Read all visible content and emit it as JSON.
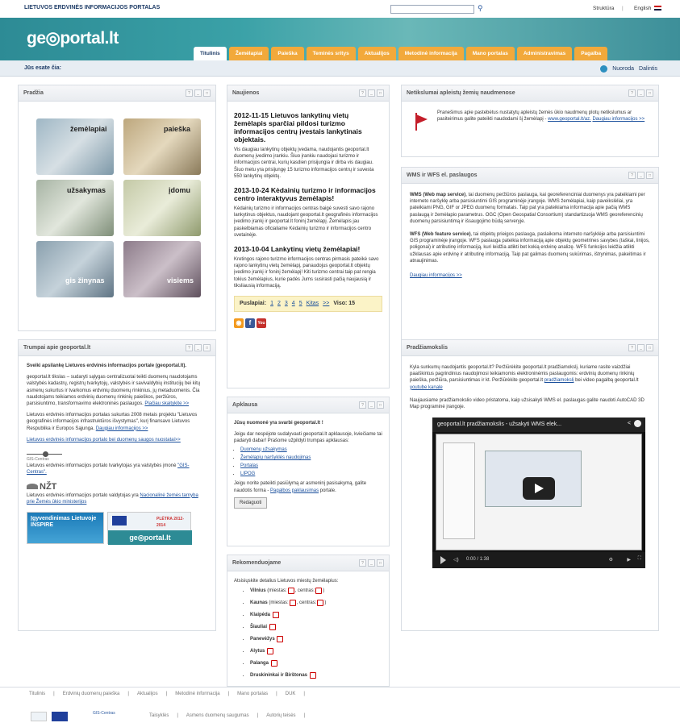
{
  "topbar": {
    "title": "LIETUVOS ERDVINĖS INFORMACIJOS PORTALAS",
    "search_placeholder": "",
    "structure": "Struktūra",
    "lang": "English"
  },
  "header": {
    "logo": "ge◎portal.lt",
    "tabs": [
      "Titulinis",
      "Žemėlapiai",
      "Paieška",
      "Teminės sritys",
      "Aktualijos",
      "Metodinė informacija",
      "Mano portalas",
      "Administravimas",
      "Pagalba"
    ]
  },
  "crumb": {
    "label": "Jūs esate čia:",
    "help": "Nuoroda",
    "share": "Dalintis"
  },
  "start": {
    "title": "Pradžia",
    "tiles": [
      "žemėlapiai",
      "paieška",
      "užsakymas",
      "įdomu",
      "gis žinynas",
      "visiems"
    ]
  },
  "about": {
    "title": "Trumpai apie geoportal.lt",
    "welcome": "Sveiki apsilankę Lietuvos erdvinės informacijos portale (geoportal.lt).",
    "p1": "geoportal.lt tikslas – sudaryti sąlygas centralizuotai teikti duomenų naudotojams valstybės kadastrų, registrų tvarkytojų, valstybės ir savivaldybių institucijų bei kitų asmenų sukurtus ir tvarkomus erdvinių duomenų rinkinius, jų metaduomenis. Čia naudotojams teikiamos erdvinių duomenų rinkinių paieškos, peržiūros, parsisiuntimo, transformavimo elektroninės paslaugos.",
    "more1": "Plačiau skaitykite >>",
    "p2": "Lietuvos erdvinės informacijos portalas sukurtas 2008 metais projektu \"Lietuvos geografinės informacijos infrastruktūros išvystymas\", kurį finansavo Lietuvos Respublika ir Europos Sąjunga.",
    "more2": "Daugiau informacijos >>",
    "link3": "Lietuvos erdvinės informacijos portalo bei duomenų saugos nuostatai>>",
    "gis": "GIS-Centras",
    "p3": "Lietuvos erdvinės informacijos portalo tvarkytojas yra valstybės įmonė",
    "gislink": "\"GIS-Centras\".",
    "nzt": "NŽT",
    "p4": "Lietuvos erdvinės informacijos portalo valdytojas yra",
    "nztlink": "Nacionalinė žemės tarnyba prie Žemės ūkio ministerijos",
    "inspire": "Įgyvendinimas Lietuvoje INSPIRE",
    "pletra": "PLĖTRA 2012-2014"
  },
  "news": {
    "title": "Naujienos",
    "items": [
      {
        "h": "2012-11-15  Lietuvos lankytinų vietų žemėlapis sparčiai pildosi turizmo informacijos centrų įvestais lankytinais objektais.",
        "t": "Vis daugiau lankytinų objektų įvedama, naudojantis geoportal.lt duomenų įvedimo įrankiu. Šiuo įrankiu naudojasi turizmo ir informacijos centrai, kurių kasdien prisijungia ir dirba vis daugiau. Šiuo metu yra prisijungę 15 turizmo informacijos centrų ir suvesta 550 lankytinų objektų."
      },
      {
        "h": "2013-10-24  Kėdainių turizmo ir informacijos centro interaktyvus žemėlapis!",
        "t": "Kėdainių turizmo ir informacijos centras baigė suvesti savo rajono lankytinus objektus, naudojant geoportal.lt geografinės informacijos įvedimo įrankį ir geoportal.lt foninį žemėlapį. Žemėlapis jau paskelbiamas oficialiame Kėdainių turizmo ir informacijos centro svetainėje."
      },
      {
        "h": "2013-10-04  Lankytinų vietų žemėlapiai!",
        "t": "Kretingos rajono turizmo informacijos centras pirmasis pateikė savo rajono lankytinų vietų žemėlapį, panaudojus geoportal.lt objektų įvedimo įrankį ir foninį žemėlapį! Kiti turizmo centrai taip pat rengia tokius žemėlapius, kurie padės Jums susirasti pačią naujausią ir tiksliausią informaciją."
      }
    ],
    "pag_label": "Puslapiai:",
    "pages": [
      "1",
      "2",
      "3",
      "4",
      "5",
      "Kitas",
      ">>"
    ],
    "total": "Viso: 15"
  },
  "poll": {
    "title": "Apklausa",
    "h": "Jūsų nuomonė yra svarbi geoportal.lt !",
    "t": "Jeigu dar nespėjote sudalyvauti geoportal.lt apklausoje, kviečiame tai padaryti dabar! Prašome užpildyti trumpas apklausas:",
    "items": [
      "Duomenų užsakymas",
      "Žemėlapių naršyklės naudojimas",
      "Portalas",
      "LIPOG"
    ],
    "t2a": "Jeigu norite pateikti pasiūlymą ar asmeninį pasisakymą, galite naudotis forma -",
    "t2link": "Pagalbos paklausimas",
    "t2b": "portale.",
    "btn": "Redaguoti"
  },
  "recs": {
    "title": "Rekomenduojame",
    "t": "Atsisiųskite detalius Lietuvos miestų žemėlapius:",
    "cities": [
      {
        "n": "Vilnius",
        "x": "(miestas:",
        "y": ", centras:",
        "z": ")"
      },
      {
        "n": "Kaunas",
        "x": "(miestas:",
        "y": ", centras:",
        "z": ")"
      },
      {
        "n": "Klaipėda"
      },
      {
        "n": "Šiauliai"
      },
      {
        "n": "Panevėžys"
      },
      {
        "n": "Alytus"
      },
      {
        "n": "Palanga"
      },
      {
        "n": "Druskininkai ir Birštonas"
      }
    ]
  },
  "unused": {
    "title": "Netikslumai apleistų žemių naudmenose",
    "t": "Pranešimus apie pastebėtus nustatytų apleistų žemės ūkio naudmenų plotų netikslumus ar pasiteirimus galite pateikti naudodami šį žemėlapį -",
    "link": "www.geoportal.lt/az.",
    "more": "Daugiau informacijos >>"
  },
  "wms": {
    "title": "WMS ir WFS el. paslaugos",
    "p1a": "WMS (Web map service)",
    "p1b": ", tai duomenų peržiūros paslauga, kai georeferenciniai duomenys yra pateikiami per interneto naršyklę arba parsisiuntimi GIS programinėje įrangoje. WMS žemėlapiai, kaip paveikslėliai, yra pateikiami PNG, GIF or JPEG duomenų formatais. Taip pat yra pateikiama informacija apie pačią WMS paslaugą ir žemėlapio parametrus. OGC (Open Geospatial Consortium) standartizuoja WMS georeferencinių duomenų parsisiuntimą ir išsaugojimo būdą serveryje.",
    "p2a": "WFS (Web feature service)",
    "p2b": ", tai objektų prieigos paslauga, paslaikoma interneto naršyklėje arba parsisiuntimi GIS programinėje įrangoje. WFS paslauga pateikia informaciją apie objektų geometrines savybes (taškai, linijos, poligonai) ir atributinę informaciją, kuri leidžia atlikti bet kokią erdvinę analizę. WFS funkcijos leidžia atlikti užklausas apie erdvinę ir atributinę informaciją. Taip pat galimas duomenų sukūrimas, ištrynimas, pakeitimas ir atnaujinimas.",
    "more": "Daugiau informacijos >>"
  },
  "guide": {
    "title": "Pradžiamokslis",
    "p1": "Kyla sunkumų naudojantis geoportal.lt? Peržiūrėkite geoportal.lt pradžiamokslį, kuriame rasite vaizdžiai paaiškintus pagrindinius naudojimosi teikiamomis elektroninėmis paslaugomis: erdvinių duomenų rinkinių paieška, peržiūra, parsisiuntimas ir kt. Peržiūrėkite geoportal.lt",
    "link1": "pradžiamokslį",
    "p1b": "bei video pagalbą geoportal.lt",
    "link2": "youtube kanale",
    "p2": "Naujausiame pradžiamokslio video pristatoma, kaip užsisakyti WMS el. paslaugas galite naudoti AutoCAD 3D Map programinė įrangoje.",
    "video_title": "geoportal.lt pradžiamokslis - užsakyti WMS elek...",
    "time": "0:00 / 1:38"
  },
  "footer": {
    "links": [
      "Titulinis",
      "Erdvinių duomenų paieška",
      "Aktualijos",
      "Metodinė informacija",
      "Mano portalas",
      "DUK"
    ],
    "links2": [
      "Taisyklės",
      "Asmens duomenų saugumas",
      "Autorių teisės"
    ],
    "gis": "GIS-Centras"
  }
}
